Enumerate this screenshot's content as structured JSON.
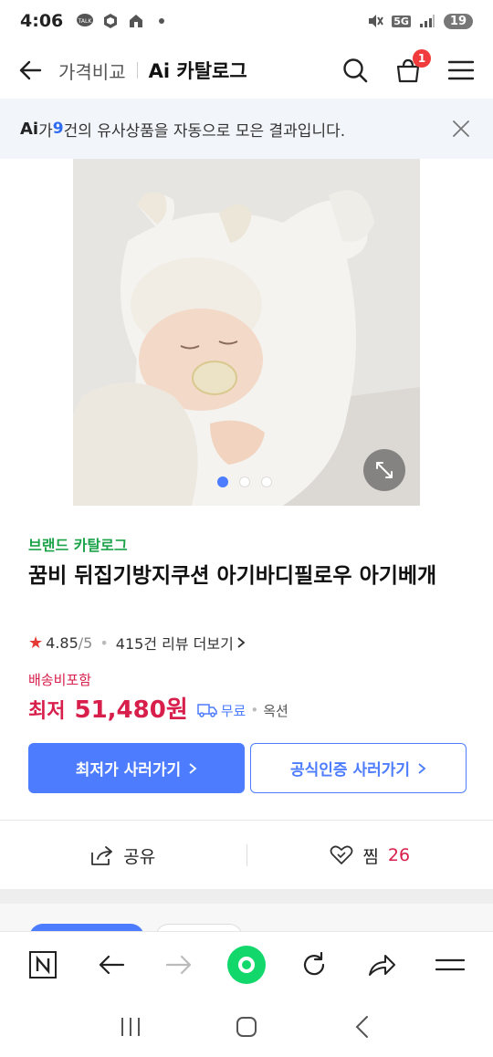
{
  "status_bar": {
    "time": "4:06",
    "network": "5G",
    "battery": "19"
  },
  "header": {
    "crumb": "가격비교",
    "title": "Ai 카탈로그",
    "cart_count": "1"
  },
  "ai_banner": {
    "logo": "Ai",
    "prefix": "가 ",
    "count": "9",
    "suffix": "건의 유사상품을 자동으로 모은 결과입니다."
  },
  "product": {
    "brand_label": "브랜드 카탈로그",
    "title": "꿈비 뒤집기방지쿠션 아기바디필로우 아기베개",
    "rating": "4.85",
    "rating_max": "/5",
    "review_text": "415건 리뷰 더보기",
    "shipping_label": "배송비포함",
    "price_label": "최저",
    "price": "51,480원",
    "free_shipping": "무료",
    "option": "옥션",
    "image_dots": 3,
    "active_dot": 0
  },
  "cta": {
    "primary": "최저가 사러가기",
    "secondary": "공식인증 사러가기"
  },
  "actions": {
    "share": "공유",
    "like": "찜",
    "like_count": "26"
  },
  "colors": {
    "accent": "#4d7cfe",
    "price": "#d81e4a",
    "brand": "#1ca34a",
    "green": "#12d86b"
  }
}
